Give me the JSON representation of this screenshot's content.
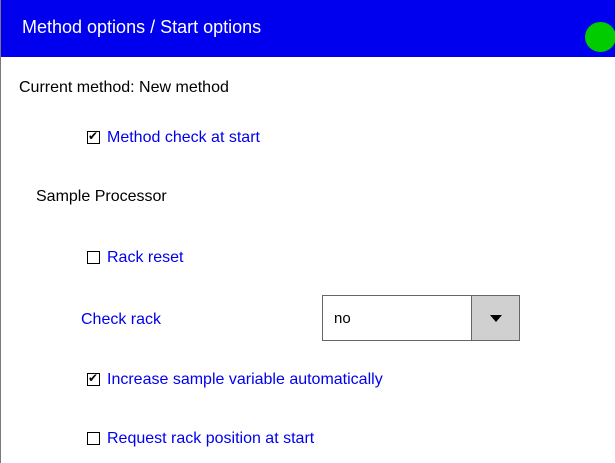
{
  "header": {
    "title": "Method options / Start options",
    "status_color": "#00cc00"
  },
  "current_method": {
    "text": "Current method: New method"
  },
  "options": {
    "method_check_at_start": {
      "label": "Method check at start",
      "checked": true,
      "checkmark": "✔"
    },
    "rack_reset": {
      "label": "Rack reset",
      "checked": false,
      "checkmark": ""
    },
    "increase_sample_variable": {
      "label": "Increase sample variable automatically",
      "checked": true,
      "checkmark": "✔"
    },
    "request_rack_position": {
      "label": "Request rack position at start",
      "checked": false,
      "checkmark": ""
    }
  },
  "sample_processor": {
    "heading": "Sample Processor"
  },
  "check_rack": {
    "label": "Check rack",
    "value": "no"
  },
  "colors": {
    "title_bar": "#0000ee",
    "link_text": "#0000ee",
    "dropdown_button": "#d0d0d0"
  }
}
